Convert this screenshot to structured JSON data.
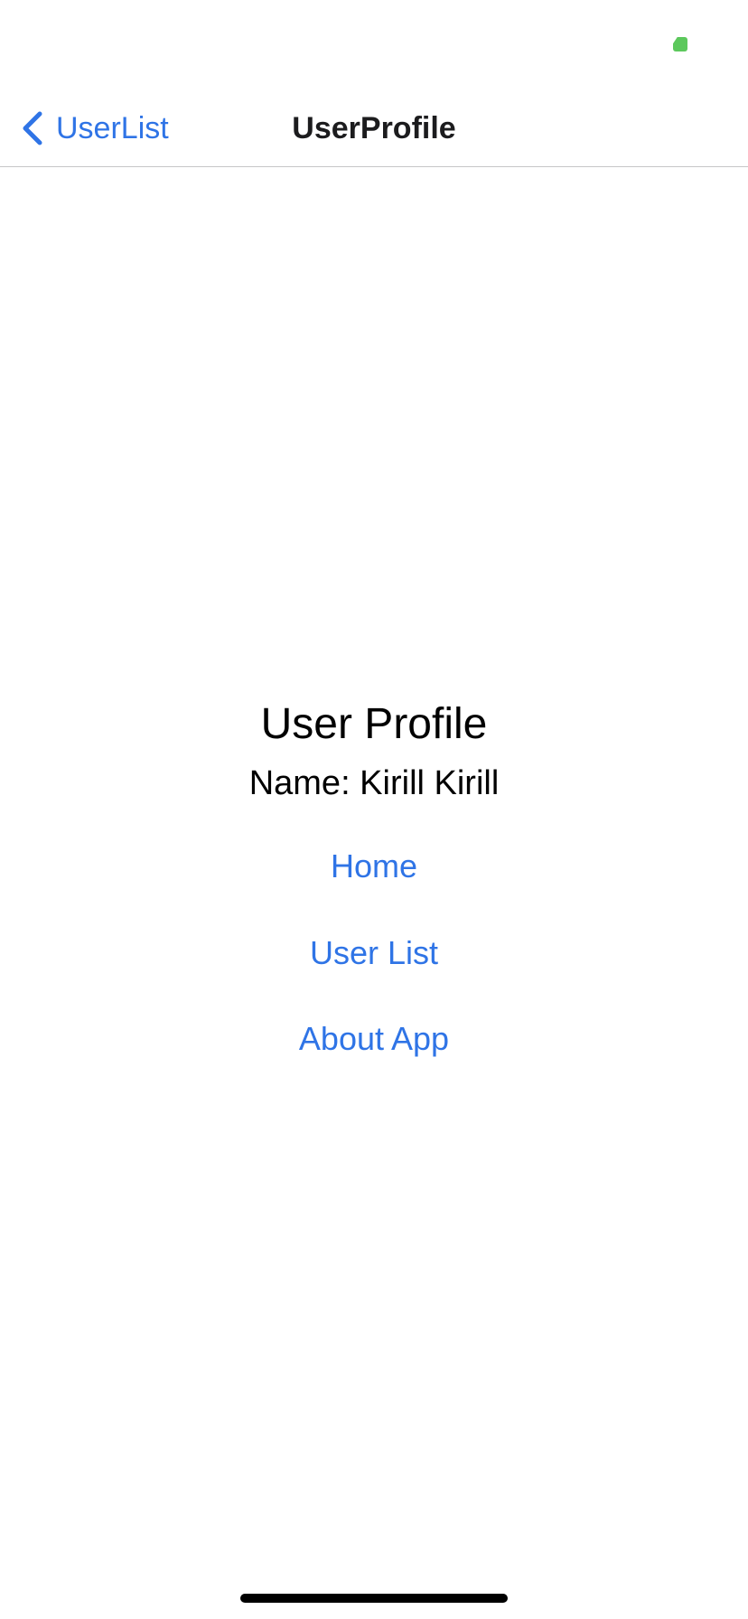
{
  "status_bar": {
    "battery_color": "#5cc85c",
    "battery_icon": "battery-icon"
  },
  "nav_bar": {
    "back_label": "UserList",
    "back_icon": "chevron-left-icon",
    "title": "UserProfile"
  },
  "profile": {
    "title": "User Profile",
    "name_line": "Name: Kirill Kirill"
  },
  "links": {
    "home": "Home",
    "user_list": "User List",
    "about": "About App"
  },
  "colors": {
    "accent": "#2f74e6",
    "text": "#000000",
    "background": "#ffffff"
  }
}
